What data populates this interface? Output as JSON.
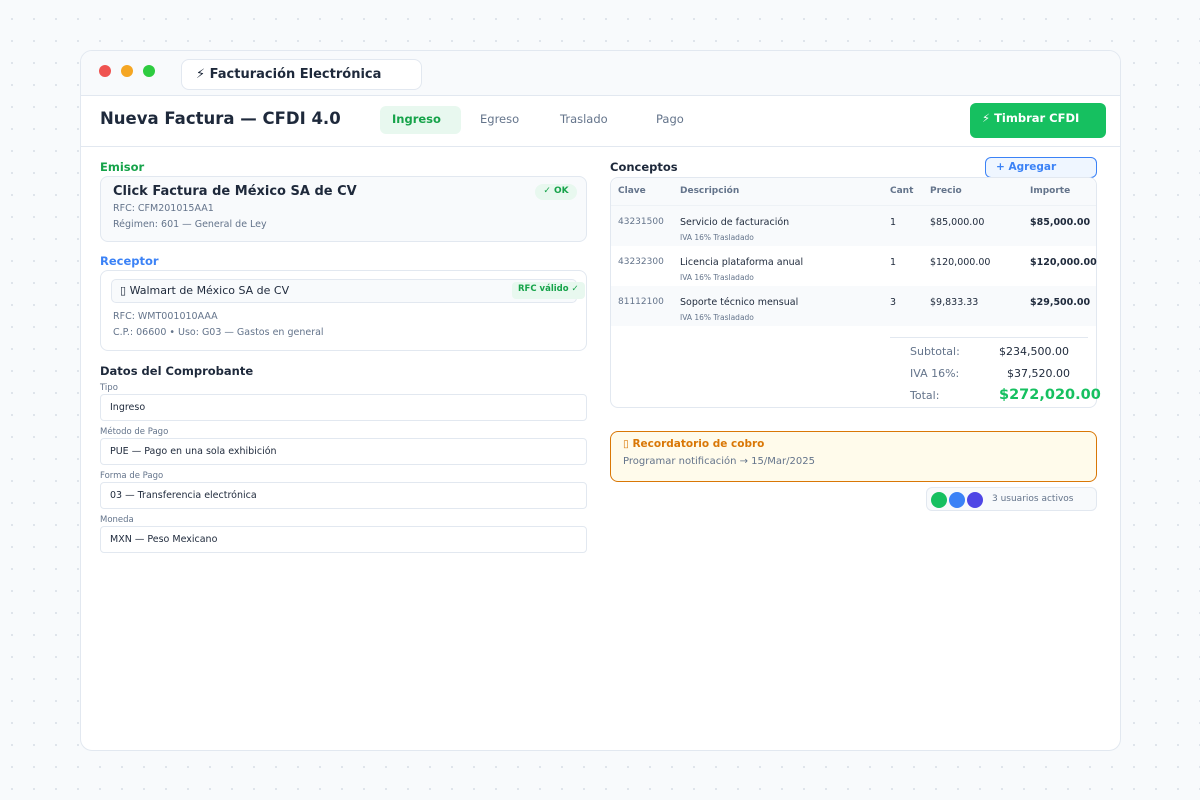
{
  "window": {
    "app_tab_label": "⚡ Facturación Electrónica"
  },
  "header": {
    "title": "Nueva Factura — CFDI 4.0",
    "tabs": [
      {
        "label": "Ingreso",
        "active": true
      },
      {
        "label": "Egreso",
        "active": false
      },
      {
        "label": "Traslado",
        "active": false
      },
      {
        "label": "Pago",
        "active": false
      }
    ],
    "timbrar_label": "⚡ Timbrar CFDI"
  },
  "emisor": {
    "section_label": "Emisor",
    "name": "Click Factura de México SA de CV",
    "rfc": "RFC: CFM201015AA1",
    "regimen": "Régimen: 601 — General de Ley",
    "status": "✓ OK"
  },
  "receptor": {
    "section_label": "Receptor",
    "search_value": "Walmart de México SA de CV",
    "rfc_status": "RFC válido ✓",
    "rfc": "RFC: WMT001010AAA",
    "cp_uso": "C.P.: 06600  •  Uso: G03 — Gastos en general"
  },
  "comprobante": {
    "section_label": "Datos del Comprobante",
    "fields": [
      {
        "label": "Tipo",
        "value": "Ingreso"
      },
      {
        "label": "Método de Pago",
        "value": "PUE — Pago en una sola exhibición"
      },
      {
        "label": "Forma de Pago",
        "value": "03 — Transferencia electrónica"
      },
      {
        "label": "Moneda",
        "value": "MXN — Peso Mexicano"
      }
    ]
  },
  "conceptos": {
    "section_label": "Conceptos",
    "add_label": "+ Agregar",
    "headers": [
      "Clave",
      "Descripción",
      "Cant",
      "Precio",
      "Importe"
    ],
    "rows": [
      {
        "clave": "43231500",
        "descripcion": "Servicio de facturación",
        "tax": "IVA 16% Trasladado",
        "cant": "1",
        "precio": "$85,000.00",
        "importe": "$85,000.00"
      },
      {
        "clave": "43232300",
        "descripcion": "Licencia plataforma anual",
        "tax": "IVA 16% Trasladado",
        "cant": "1",
        "precio": "$120,000.00",
        "importe": "$120,000.00"
      },
      {
        "clave": "81112100",
        "descripcion": "Soporte técnico mensual",
        "tax": "IVA 16% Trasladado",
        "cant": "3",
        "precio": "$9,833.33",
        "importe": "$29,500.00"
      }
    ],
    "totals": {
      "subtotal_label": "Subtotal:",
      "subtotal": "$234,500.00",
      "iva_label": "IVA 16%:",
      "iva": "$37,520.00",
      "total_label": "Total:",
      "total": "$272,020.00"
    }
  },
  "reminder": {
    "title": "Recordatorio de cobro",
    "text": "Programar notificación → 15/Mar/2025"
  },
  "presence": {
    "text": "3 usuarios activos",
    "avatar_colors": [
      "#16c060",
      "#3b82f6",
      "#4f46e5"
    ]
  },
  "colors": {
    "accent_green": "#16c060",
    "accent_blue": "#3b82f6",
    "warning": "#d97706"
  }
}
